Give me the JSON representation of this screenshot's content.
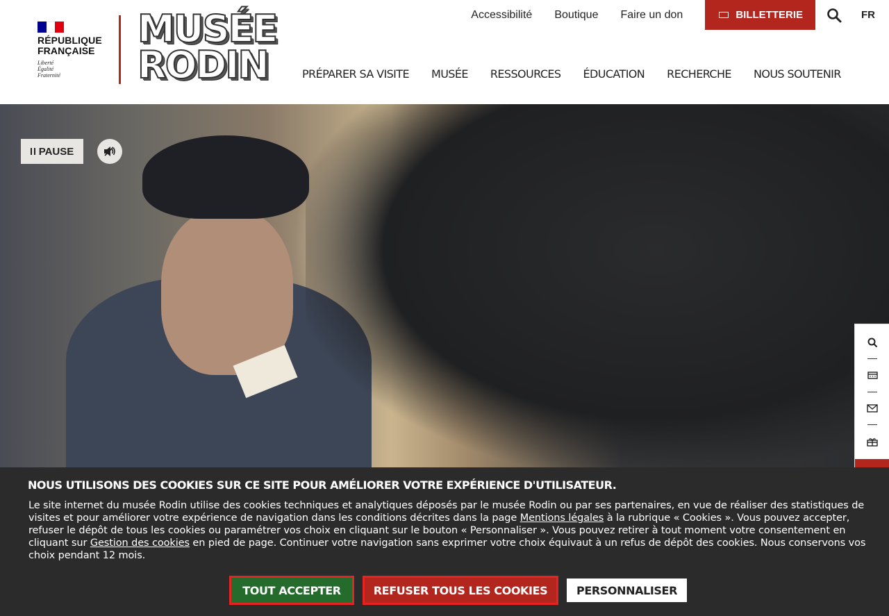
{
  "header": {
    "republique": {
      "name_line1": "RÉPUBLIQUE",
      "name_line2": "FRANÇAISE",
      "motto_line1": "Liberté",
      "motto_line2": "Égalité",
      "motto_line3": "Fraternité",
      "flag_colors": [
        "#000091",
        "#ffffff",
        "#e1000f"
      ]
    },
    "logo": {
      "line1": "MUSÉE",
      "line2": "RODIN"
    },
    "top_links": [
      {
        "label": "Accessibilité"
      },
      {
        "label": "Boutique"
      },
      {
        "label": "Faire un don"
      }
    ],
    "billetterie_label": "BILLETTERIE",
    "language": "FR",
    "nav": [
      {
        "label": "PRÉPARER SA VISITE"
      },
      {
        "label": "MUSÉE"
      },
      {
        "label": "RESSOURCES"
      },
      {
        "label": "ÉDUCATION"
      },
      {
        "label": "RECHERCHE"
      },
      {
        "label": "NOUS SOUTENIR"
      }
    ]
  },
  "hero": {
    "pause_label": "PAUSE",
    "sound_icon": "sound-on-icon"
  },
  "side_tools": [
    {
      "icon": "search-icon"
    },
    {
      "icon": "calendar-icon"
    },
    {
      "icon": "mail-icon"
    },
    {
      "icon": "gift-icon"
    }
  ],
  "cookie_banner": {
    "title": "NOUS UTILISONS DES COOKIES SUR CE SITE POUR AMÉLIORER VOTRE EXPÉRIENCE D'UTILISATEUR.",
    "text_part1": "Le site internet du musée Rodin utilise des cookies techniques et analytiques déposés par le musée Rodin ou par ses partenaires, en vue de réaliser des statistiques de visites et pour améliorer votre expérience de navigation dans les conditions décrites dans la page ",
    "link1": "Mentions légales",
    "text_part2": " à la rubrique « Cookies ». Vous pouvez accepter, refuser le dépôt de tous les cookies ou paramétrer vos choix en cliquant sur le bouton « Personnaliser ». Vous pouvez retirer à tout moment votre consentement en cliquant sur ",
    "link2": "Gestion des cookies",
    "text_part3": " en pied de page. Continuer votre navigation sans exprimer votre choix équivaut à un refus de dépôt des cookies. Nous conservons vos choix pendant 12 mois.",
    "accept_label": "TOUT ACCEPTER",
    "refuse_label": "REFUSER TOUS LES COOKIES",
    "customize_label": "PERSONNALISER"
  },
  "colors": {
    "brand_red": "#b3261e",
    "accept_green": "#256b2c",
    "banner_bg": "#2b2b2b"
  }
}
